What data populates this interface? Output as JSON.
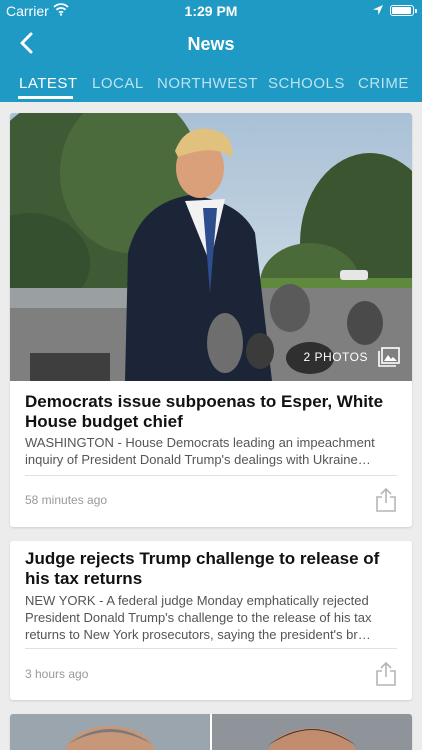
{
  "status_bar": {
    "carrier": "Carrier",
    "time": "1:29 PM"
  },
  "header": {
    "title": "News"
  },
  "tabs": [
    {
      "label": "LATEST",
      "active": true
    },
    {
      "label": "LOCAL",
      "active": false
    },
    {
      "label": "NORTHWEST",
      "active": false
    },
    {
      "label": "SCHOOLS",
      "active": false
    },
    {
      "label": "CRIME",
      "active": false
    }
  ],
  "articles": [
    {
      "photo_count": "2 PHOTOS",
      "headline": "Democrats issue subpoenas to Esper, White House budget chief",
      "summary": "WASHINGTON - House Democrats leading an impeachment inquiry of President Donald Trump's dealings with Ukraine…",
      "timestamp": "58 minutes ago"
    },
    {
      "headline": "Judge rejects Trump challenge to release of his tax returns",
      "summary": "NEW YORK - A federal judge Monday emphatically rejected President Donald Trump's challenge to the release of his tax returns to New York prosecutors, saying the president's br…",
      "timestamp": "3 hours ago"
    }
  ],
  "colors": {
    "header_bg": "#1e9ac4",
    "page_bg": "#ececec"
  },
  "icons": [
    "wifi-icon",
    "location-arrow-icon",
    "battery-icon",
    "back-chevron-icon",
    "gallery-icon",
    "share-icon"
  ]
}
